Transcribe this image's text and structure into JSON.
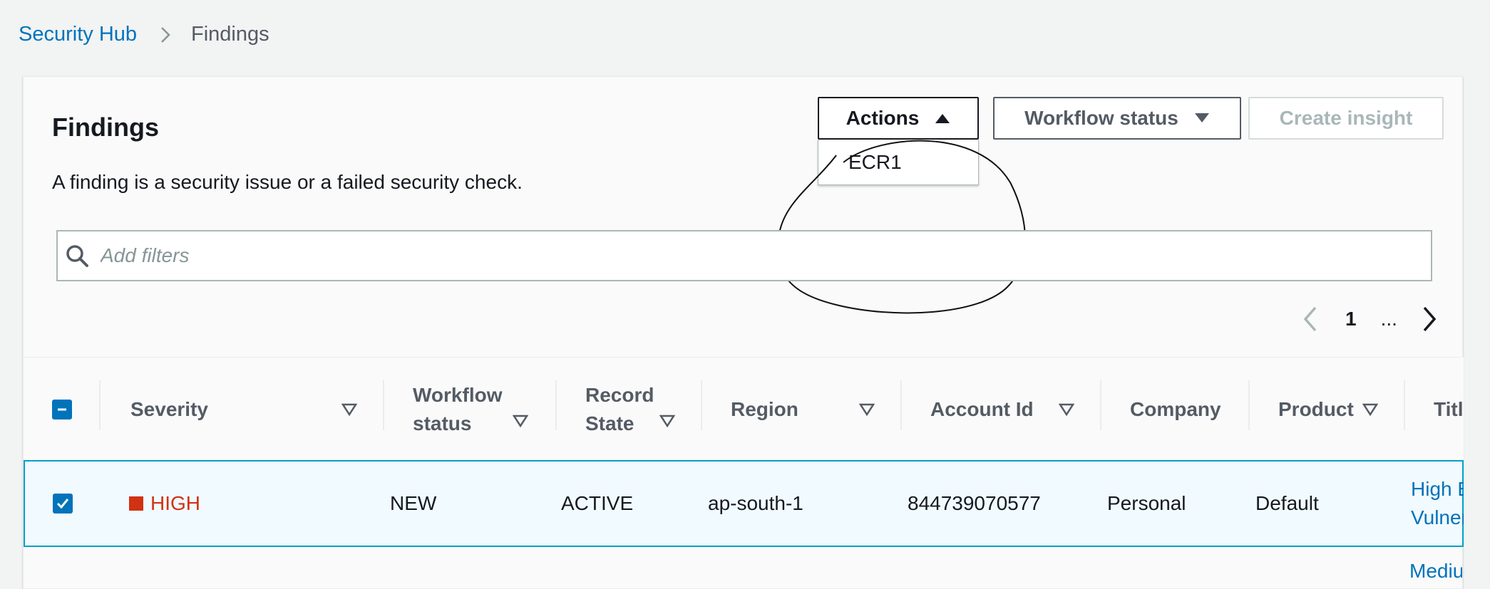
{
  "breadcrumb": {
    "root": "Security Hub",
    "current": "Findings"
  },
  "panel": {
    "title": "Findings",
    "description": "A finding is a security issue or a failed security check."
  },
  "actions": {
    "actions_label": "Actions",
    "workflow_label": "Workflow status",
    "insight_label": "Create insight",
    "menu_items": [
      "ECR1"
    ]
  },
  "search": {
    "placeholder": "Add filters"
  },
  "pagination": {
    "page": "1",
    "ellipsis": "..."
  },
  "table": {
    "columns": {
      "severity": "Severity",
      "workflow_status_line1": "Workflow",
      "workflow_status_line2": "status",
      "record_state_line1": "Record",
      "record_state_line2": "State",
      "region": "Region",
      "account_id": "Account Id",
      "company": "Company",
      "product": "Product",
      "title": "Title"
    },
    "rows": [
      {
        "severity": "HIGH",
        "workflow": "NEW",
        "record_state": "ACTIVE",
        "region": "ap-south-1",
        "account_id": "844739070577",
        "company": "Personal",
        "product": "Default",
        "title_line1": "High E",
        "title_line2": "Vulner"
      }
    ],
    "next_row_title_fragment": "Mediu"
  },
  "colors": {
    "link": "#0073bb",
    "severity_high": "#d13212",
    "selected_row_bg": "#f1faff",
    "selected_row_border": "#00a1c9"
  }
}
